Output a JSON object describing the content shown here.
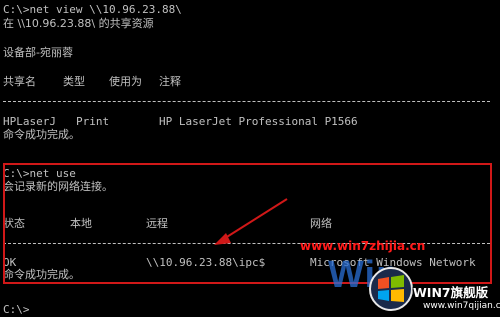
{
  "console": {
    "cmd_view": "C:\\>net view \\\\10.96.23.88\\",
    "shared_on": "在 \\\\10.96.23.88\\ 的共享资源",
    "device_name": "设备部-宛丽蓉",
    "share_headers": {
      "share_name": "共享名",
      "type": "类型",
      "used_as": "使用为",
      "comment": "注释"
    },
    "share_row": {
      "name": "HPLaserJ",
      "type": "Print",
      "comment": "HP LaserJet Professional P1566"
    },
    "success_1": "命令成功完成。",
    "cmd_use": "C:\\>net use",
    "remember_msg": "会记录新的网络连接。",
    "use_headers": {
      "status": "状态",
      "local": "本地",
      "remote": "远程",
      "network": "网络"
    },
    "use_row": {
      "status": "OK",
      "remote": "\\\\10.96.23.88\\ipc$",
      "network": "Microsoft Windows Network"
    },
    "success_2": "命令成功完成。",
    "prompt": "C:\\>"
  },
  "annotation": {
    "box_color": "#d01818",
    "arrow_color": "#d01818"
  },
  "watermark": {
    "url": "www.win7zhijia.cn",
    "logo": "Win",
    "badge_title": "WIN7旗舰版",
    "badge_url": "www.win7qijian.com"
  }
}
